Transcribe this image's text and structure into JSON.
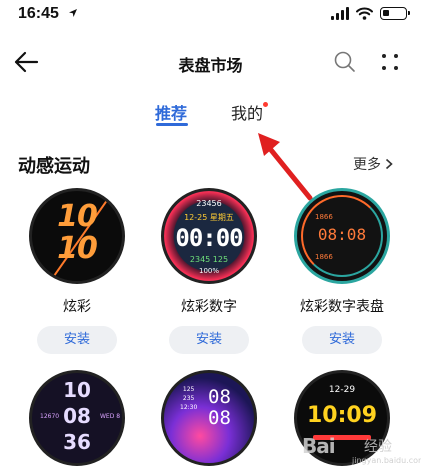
{
  "status_bar": {
    "time": "16:45",
    "battery_level": 0.3
  },
  "nav": {
    "title": "表盘市场",
    "back_icon": "arrow-left-icon",
    "search_icon": "search-icon",
    "more_icon": "four-dots-icon"
  },
  "tabs": [
    {
      "label": "推荐",
      "active": true
    },
    {
      "label": "我的",
      "active": false,
      "badge_dot": true
    }
  ],
  "section": {
    "title": "动感运动",
    "more_label": "更多"
  },
  "watches": [
    {
      "name": "炫彩",
      "install_label": "安装",
      "face": {
        "digits": [
          "10",
          "10"
        ]
      }
    },
    {
      "name": "炫彩数字",
      "install_label": "安装",
      "face": {
        "top": "23456",
        "date": "12-25  星期五",
        "time": "00:00",
        "bottom": "2345  125",
        "pct": "100%"
      }
    },
    {
      "name": "炫彩数字表盘",
      "install_label": "安装",
      "face": {
        "time": "08:08",
        "stat1": "1866",
        "stat2": "1866"
      }
    },
    {
      "name": "",
      "install_label": "",
      "face": {
        "digits": [
          "10",
          "08",
          "36"
        ],
        "left": "12670",
        "right": "WED 8"
      }
    },
    {
      "name": "",
      "install_label": "",
      "face": {
        "digits": [
          "08",
          "08"
        ],
        "small": "125\n235\n12:30"
      }
    },
    {
      "name": "",
      "install_label": "",
      "face": {
        "top": "12-29",
        "time": "10:09"
      }
    }
  ],
  "watermark": {
    "logo_text": "Bai",
    "cn_text": "经验",
    "url": "jingyan.baidu.com"
  },
  "colors": {
    "accent": "#2f6ad9",
    "badge": "#ff3b30",
    "annotation_arrow": "#e02020"
  }
}
